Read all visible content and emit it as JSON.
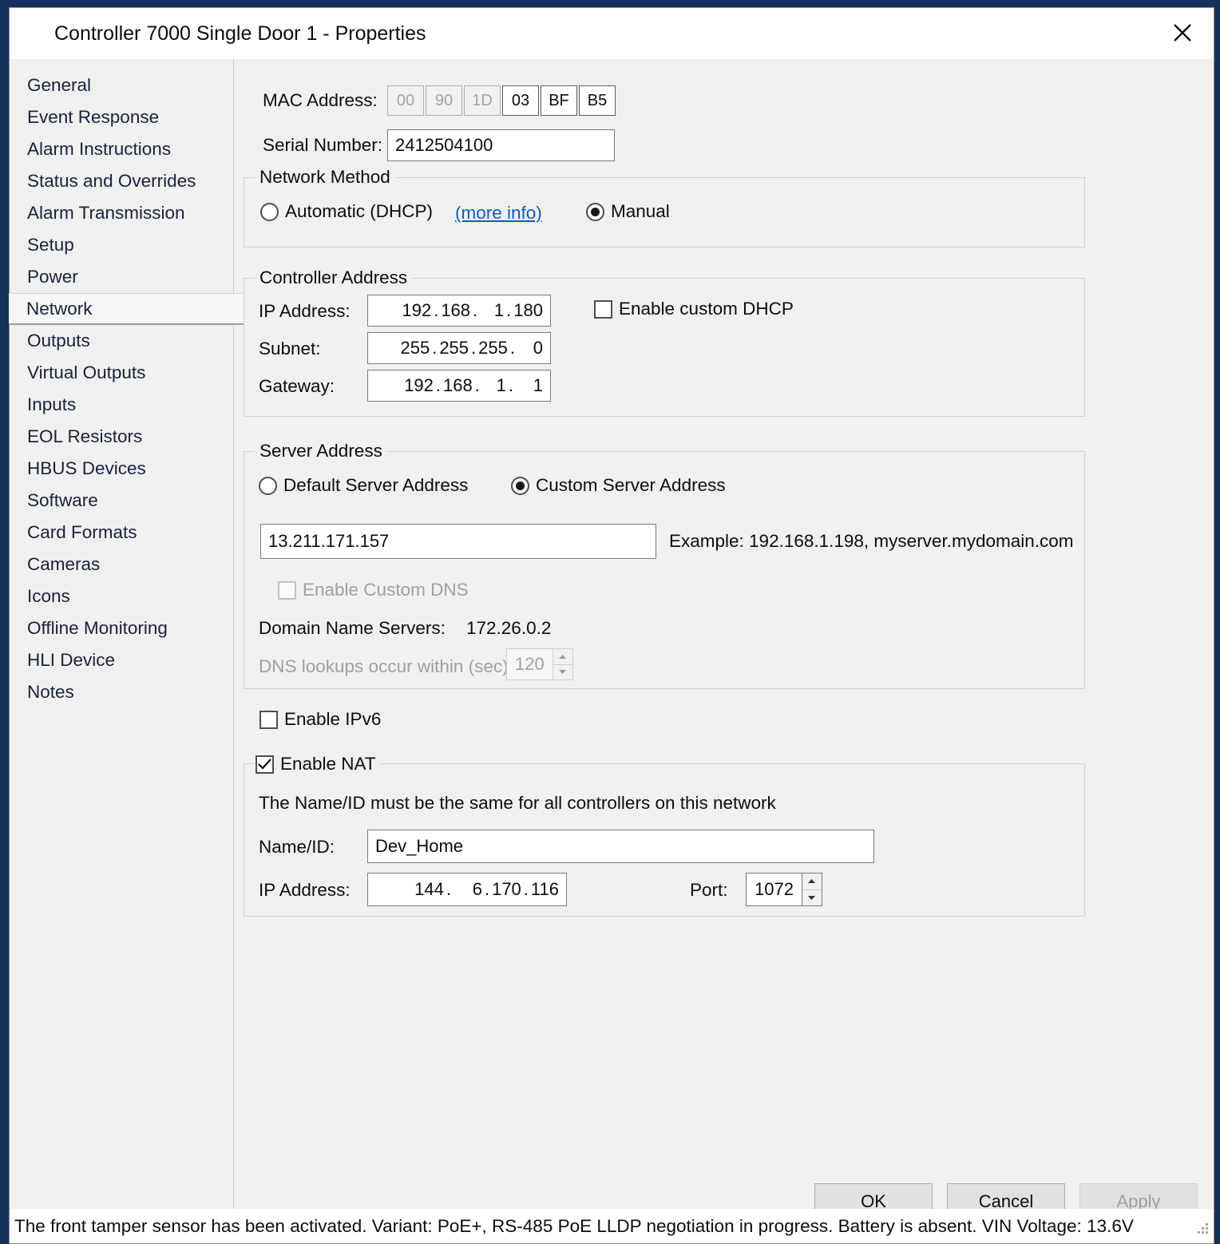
{
  "window": {
    "title": "Controller 7000 Single Door 1 - Properties",
    "close_label": "Close"
  },
  "sidebar": {
    "items": [
      {
        "label": "General",
        "selected": false
      },
      {
        "label": "Event Response",
        "selected": false
      },
      {
        "label": "Alarm Instructions",
        "selected": false
      },
      {
        "label": "Status and Overrides",
        "selected": false
      },
      {
        "label": "Alarm Transmission",
        "selected": false
      },
      {
        "label": "Setup",
        "selected": false
      },
      {
        "label": "Power",
        "selected": false
      },
      {
        "label": "Network",
        "selected": true
      },
      {
        "label": "Outputs",
        "selected": false
      },
      {
        "label": "Virtual Outputs",
        "selected": false
      },
      {
        "label": "Inputs",
        "selected": false
      },
      {
        "label": "EOL Resistors",
        "selected": false
      },
      {
        "label": "HBUS Devices",
        "selected": false
      },
      {
        "label": "Software",
        "selected": false
      },
      {
        "label": "Card Formats",
        "selected": false
      },
      {
        "label": "Cameras",
        "selected": false
      },
      {
        "label": "Icons",
        "selected": false
      },
      {
        "label": "Offline Monitoring",
        "selected": false
      },
      {
        "label": "HLI Device",
        "selected": false
      },
      {
        "label": "Notes",
        "selected": false
      }
    ]
  },
  "mac": {
    "label": "MAC Address:",
    "octets": [
      "00",
      "90",
      "1D",
      "03",
      "BF",
      "B5"
    ],
    "editable_from_index": 3
  },
  "serial": {
    "label": "Serial Number:",
    "value": "2412504100"
  },
  "network_method": {
    "title": "Network Method",
    "automatic_label": "Automatic (DHCP)",
    "more_info_label": "(more info)",
    "manual_label": "Manual",
    "selected": "Manual"
  },
  "controller_address": {
    "title": "Controller Address",
    "ip_label": "IP Address:",
    "ip_octets": [
      "192",
      "168",
      "1",
      "180"
    ],
    "subnet_label": "Subnet:",
    "subnet_octets": [
      "255",
      "255",
      "255",
      "0"
    ],
    "gateway_label": "Gateway:",
    "gateway_octets": [
      "192",
      "168",
      "1",
      "1"
    ],
    "custom_dhcp_label": "Enable custom DHCP",
    "custom_dhcp_checked": false
  },
  "server_address": {
    "title": "Server Address",
    "default_label": "Default Server Address",
    "custom_label": "Custom Server Address",
    "selected": "Custom Server Address",
    "server_value": "13.211.171.157",
    "example_label": "Example: 192.168.1.198, myserver.mydomain.com",
    "custom_dns_label": "Enable Custom DNS",
    "custom_dns_checked": false,
    "custom_dns_enabled": false,
    "dns_servers_label": "Domain Name Servers:",
    "dns_servers_value": "172.26.0.2",
    "dns_lookup_label": "DNS lookups occur within (sec):",
    "dns_lookup_value": "120",
    "dns_lookup_enabled": false
  },
  "ipv6": {
    "label": "Enable IPv6",
    "checked": false
  },
  "nat": {
    "label": "Enable NAT",
    "checked": true,
    "note": "The Name/ID must be the same for all controllers on this network",
    "name_label": "Name/ID:",
    "name_value": "Dev_Home",
    "ip_label": "IP Address:",
    "ip_octets": [
      "144",
      "6",
      "170",
      "116"
    ],
    "port_label": "Port:",
    "port_value": "1072"
  },
  "footer": {
    "ok": "OK",
    "cancel": "Cancel",
    "apply": "Apply",
    "apply_enabled": false
  },
  "statusbar": {
    "text": "The front tamper sensor has been activated.   Variant: PoE+, RS-485  PoE LLDP negotiation in progress.  Battery is absent.  VIN Voltage: 13.6V"
  },
  "colors": {
    "window_border": "#14305c",
    "accent_link": "#0c5dbd",
    "panel_bg": "#f0f0f0"
  }
}
